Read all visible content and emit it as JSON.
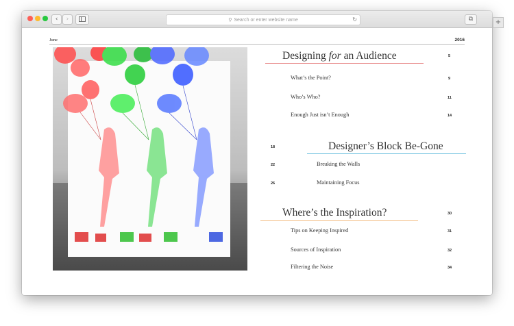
{
  "browser": {
    "address_placeholder": "Search or enter website name",
    "back_glyph": "‹",
    "forward_glyph": "›",
    "sidebar_icon": "sidebar-icon",
    "reload_glyph": "↻",
    "tabs_glyph": "⧉",
    "new_tab_glyph": "+",
    "magnifier_glyph": "⚲",
    "colors": {
      "close": "#fd5f57",
      "minimize": "#febb2f",
      "zoom": "#28c840"
    }
  },
  "page": {
    "month": "June",
    "year": "2016",
    "sections": [
      {
        "title_before": "Designing ",
        "title_italic": "for",
        "title_after": " an Audience",
        "page": "5",
        "underline_color": "#e88a8a",
        "items": [
          {
            "label": "What’s the Point?",
            "page": "9"
          },
          {
            "label": "Who’s Who?",
            "page": "11"
          },
          {
            "label": "Enough Just isn’t Enough",
            "page": "14"
          }
        ]
      },
      {
        "title": "Designer’s Block Be-Gone",
        "page": "18",
        "underline_color": "#6ec1df",
        "items": [
          {
            "label": "Breaking the Walls",
            "page": "22"
          },
          {
            "label": "Maintaining Focus",
            "page": "26"
          }
        ]
      },
      {
        "title": "Where’s the Inspiration?",
        "page": "30",
        "underline_color": "#f2b97c",
        "items": [
          {
            "label": "Tips on Keeping Inspired",
            "page": "31"
          },
          {
            "label": "Sources of Inspiration",
            "page": "32"
          },
          {
            "label": "Filtering the Noise",
            "page": "34"
          }
        ]
      }
    ]
  }
}
